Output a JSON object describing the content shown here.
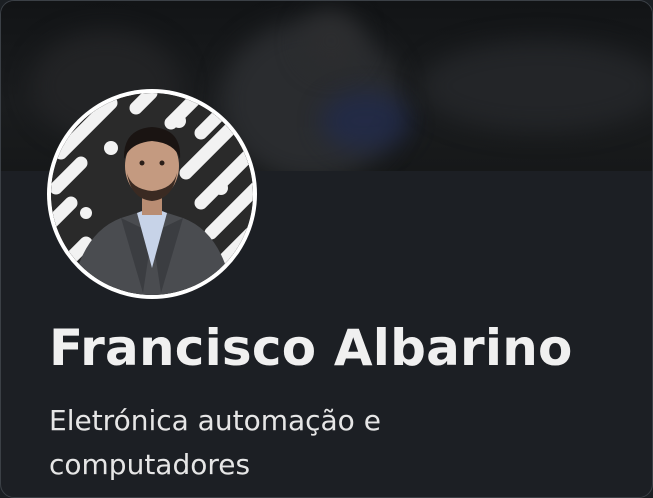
{
  "profile": {
    "name": "Francisco Albarino",
    "headline": "Eletrónica automação e computadores"
  },
  "icons": {
    "avatar": "profile-photo",
    "cover": "cover-photo"
  },
  "colors": {
    "background": "#1c1f24",
    "name_text": "#f0f0f0",
    "headline_text": "#e6e6e6",
    "avatar_ring": "#ffffff",
    "card_border": "#3b4046"
  }
}
